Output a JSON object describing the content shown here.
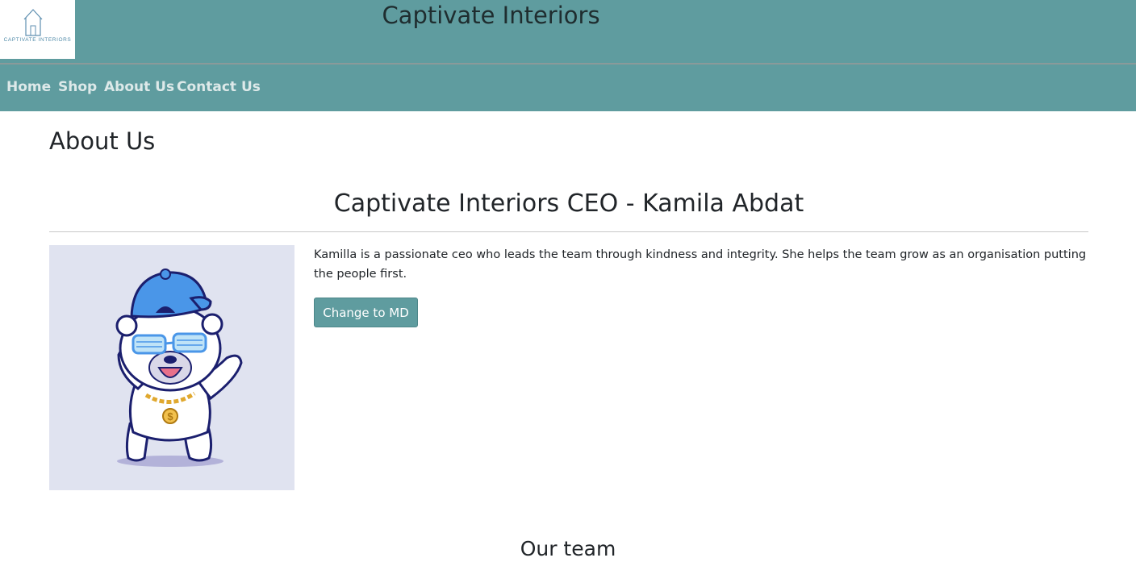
{
  "header": {
    "logo_text": "CAPTIVATE INTERIORS",
    "site_title": "Captivate Interiors",
    "background_color": "#5f9c9f"
  },
  "nav": {
    "items": [
      {
        "label": "Home"
      },
      {
        "label": "Shop"
      },
      {
        "label": "About Us"
      },
      {
        "label": "Contact Us"
      }
    ]
  },
  "main": {
    "page_heading": "About Us",
    "ceo_heading": "Captivate Interiors CEO - Kamila Abdat",
    "bio": "Kamilla is a passionate ceo who leads the team through kindness and integrity. She helps the team grow as an organisation putting the people first.",
    "change_button_label": "Change to MD",
    "team_heading": "Our team"
  },
  "icons": {
    "logo": "house-logo-icon",
    "profile_image": "polar-bear-illustration"
  }
}
